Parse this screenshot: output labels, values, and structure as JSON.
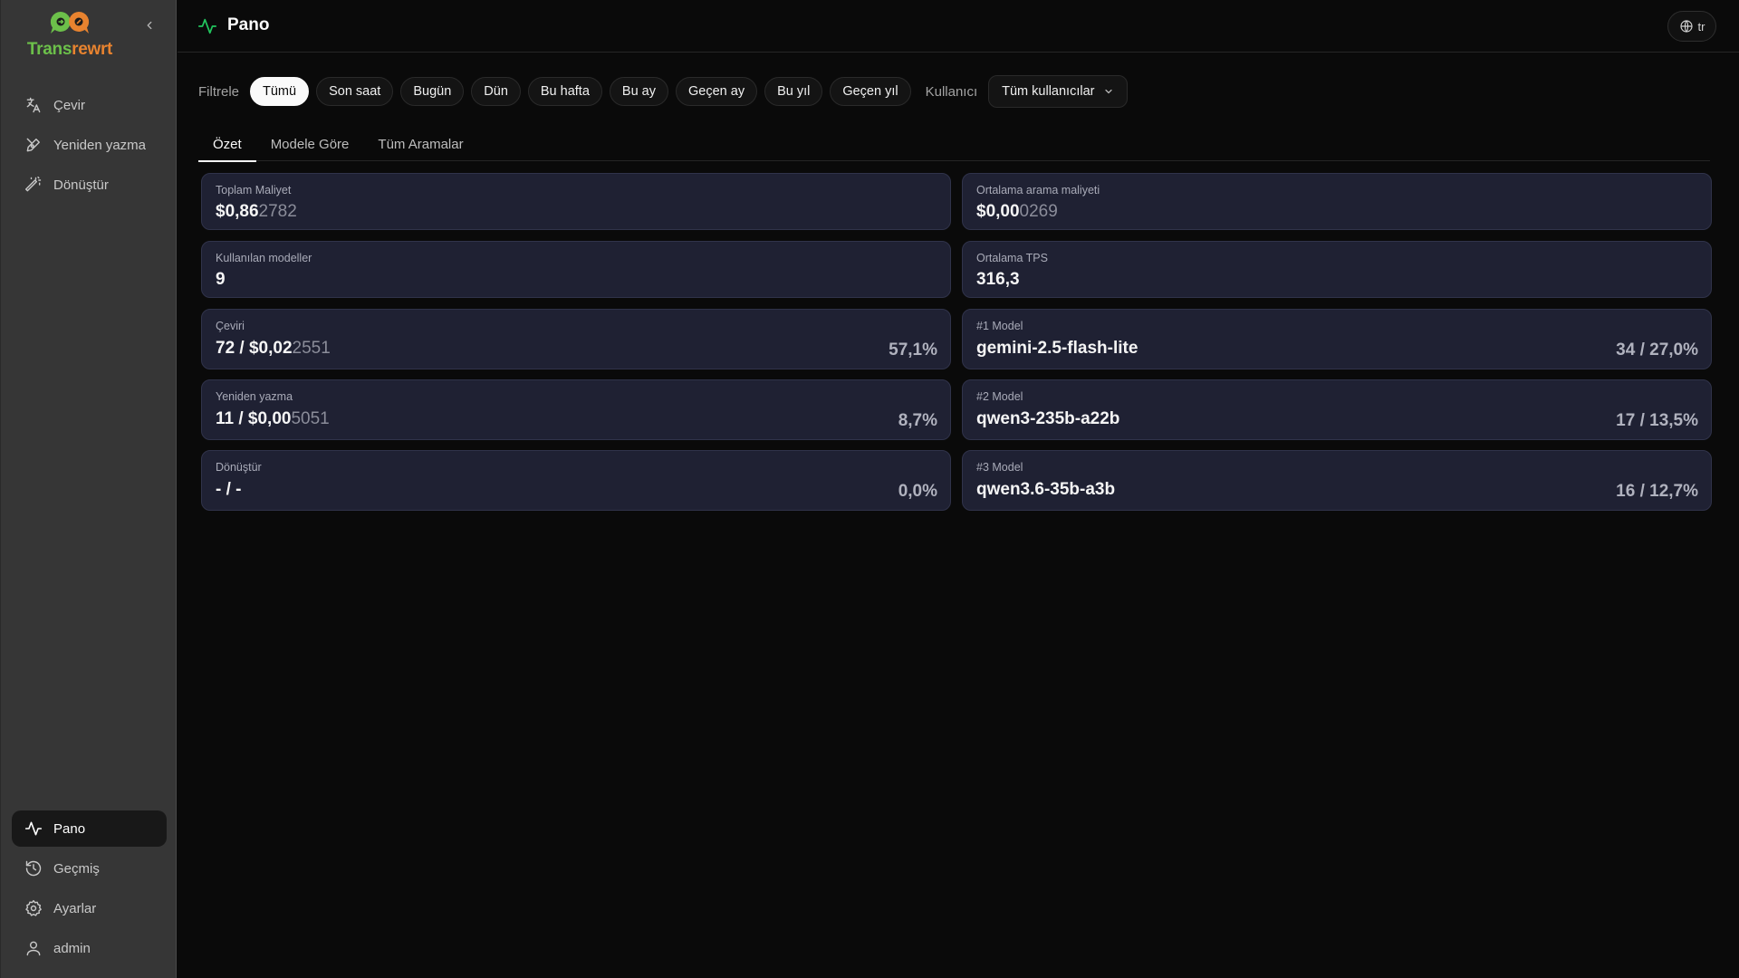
{
  "app": {
    "name_part1": "Trans",
    "name_part2": "rewrt",
    "colors": {
      "green": "#6cc04a",
      "orange": "#e8832f"
    }
  },
  "sidebar": {
    "items": [
      {
        "label": "Çevir",
        "icon": "translate-icon"
      },
      {
        "label": "Yeniden yazma",
        "icon": "pen-icon"
      },
      {
        "label": "Dönüştür",
        "icon": "magic-wand-icon"
      }
    ],
    "bottom_items": [
      {
        "label": "Pano",
        "icon": "activity-icon",
        "active": true
      },
      {
        "label": "Geçmiş",
        "icon": "history-icon"
      },
      {
        "label": "Ayarlar",
        "icon": "gear-icon"
      },
      {
        "label": "admin",
        "icon": "user-icon"
      }
    ]
  },
  "header": {
    "title": "Pano",
    "lang": "tr",
    "accent": "#22c55e"
  },
  "filters": {
    "label": "Filtrele",
    "chips": [
      "Tümü",
      "Son saat",
      "Bugün",
      "Dün",
      "Bu hafta",
      "Bu ay",
      "Geçen ay",
      "Bu yıl",
      "Geçen yıl"
    ],
    "active": "Tümü",
    "user_label": "Kullanıcı",
    "user_value": "Tüm kullanıcılar"
  },
  "tabs": [
    {
      "label": "Özet",
      "active": true
    },
    {
      "label": "Modele Göre"
    },
    {
      "label": "Tüm Aramalar"
    }
  ],
  "cards": {
    "total_cost": {
      "label": "Toplam Maliyet",
      "main": "$0,86",
      "dim": "2782"
    },
    "avg_cost": {
      "label": "Ortalama arama maliyeti",
      "main": "$0,00",
      "dim": "0269"
    },
    "models_used": {
      "label": "Kullanılan modeller",
      "main": "9"
    },
    "avg_tps": {
      "label": "Ortalama TPS",
      "main": "316,3"
    },
    "translate": {
      "label": "Çeviri",
      "main": "72 / $0,02",
      "dim": "2551",
      "pct": "57,1%"
    },
    "rewrite": {
      "label": "Yeniden yazma",
      "main": "11 / $0,00",
      "dim": "5051",
      "pct": "8,7%"
    },
    "convert": {
      "label": "Dönüştür",
      "main": "- / -",
      "pct": "0,0%"
    },
    "model1": {
      "label": "#1 Model",
      "main": "gemini-2.5-flash-lite",
      "pct": "34 / 27,0%"
    },
    "model2": {
      "label": "#2 Model",
      "main": "qwen3-235b-a22b",
      "pct": "17 / 13,5%"
    },
    "model3": {
      "label": "#3 Model",
      "main": "qwen3.6-35b-a3b",
      "pct": "16 / 12,7%"
    }
  }
}
